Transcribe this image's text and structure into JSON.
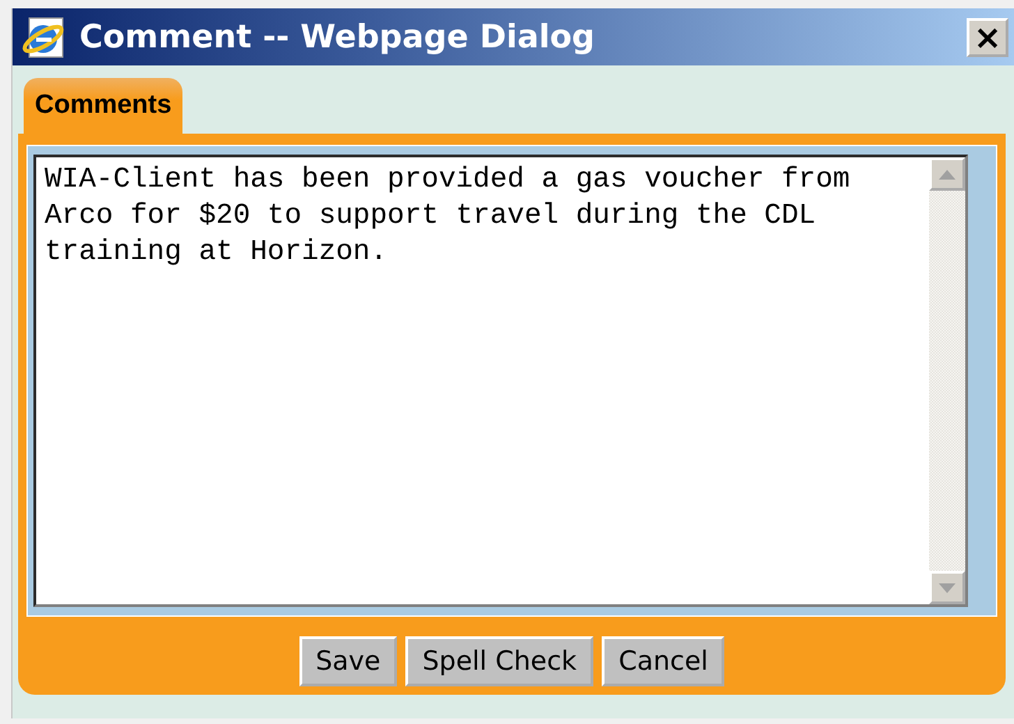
{
  "window": {
    "title": "Comment -- Webpage Dialog",
    "close": "×"
  },
  "tabs": [
    {
      "label": "Comments",
      "selected": true
    }
  ],
  "comment": {
    "value": "WIA-Client has been provided a gas voucher from Arco for $20 to support travel during the CDL training at Horizon."
  },
  "buttons": [
    "Save",
    "Spell Check",
    "Cancel"
  ]
}
